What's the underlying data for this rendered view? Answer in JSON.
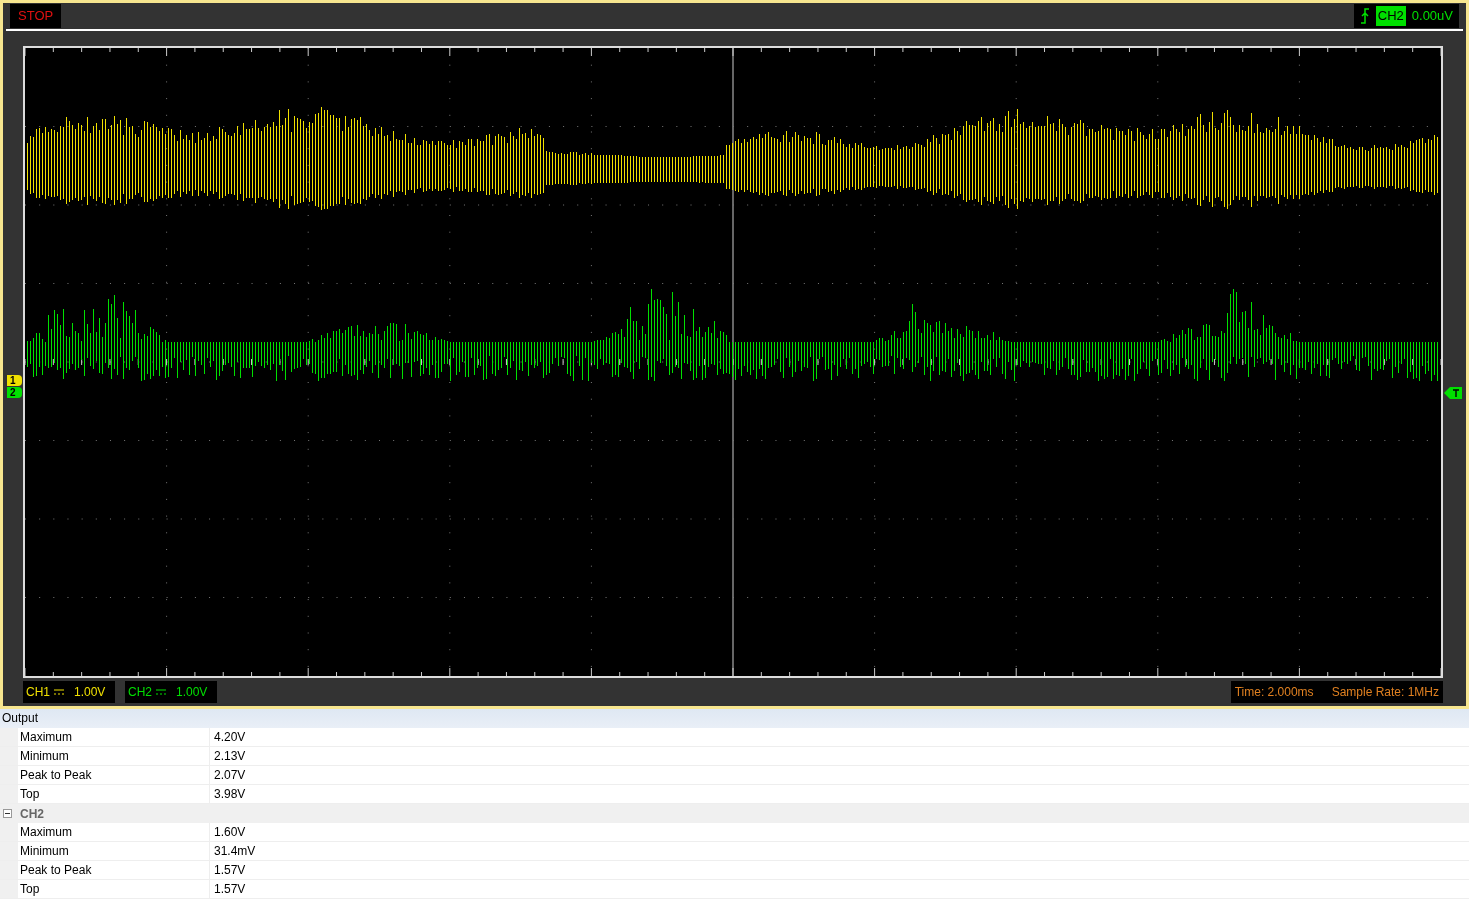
{
  "scope": {
    "run_state": "STOP",
    "trigger": {
      "channel": "CH2",
      "level": "0.00uV"
    },
    "channels": [
      {
        "label": "CH1",
        "scale": "1.00V",
        "marker": "1",
        "color": "#f0e000"
      },
      {
        "label": "CH2",
        "scale": "1.00V",
        "marker": "2",
        "color": "#00e000"
      }
    ],
    "time": "Time: 2.000ms",
    "sample_rate": "Sample Rate: 1MHz"
  },
  "output": {
    "title": "Output",
    "groups": [
      {
        "rows": [
          {
            "name": "Maximum",
            "value": "4.20V"
          },
          {
            "name": "Minimum",
            "value": "2.13V"
          },
          {
            "name": "Peak to Peak",
            "value": "2.07V"
          },
          {
            "name": "Top",
            "value": "3.98V"
          }
        ]
      },
      {
        "name": "CH2",
        "expanded": true,
        "rows": [
          {
            "name": "Maximum",
            "value": "1.60V"
          },
          {
            "name": "Minimum",
            "value": "31.4mV"
          },
          {
            "name": "Peak to Peak",
            "value": "1.57V"
          },
          {
            "name": "Top",
            "value": "1.57V"
          }
        ]
      }
    ]
  }
}
